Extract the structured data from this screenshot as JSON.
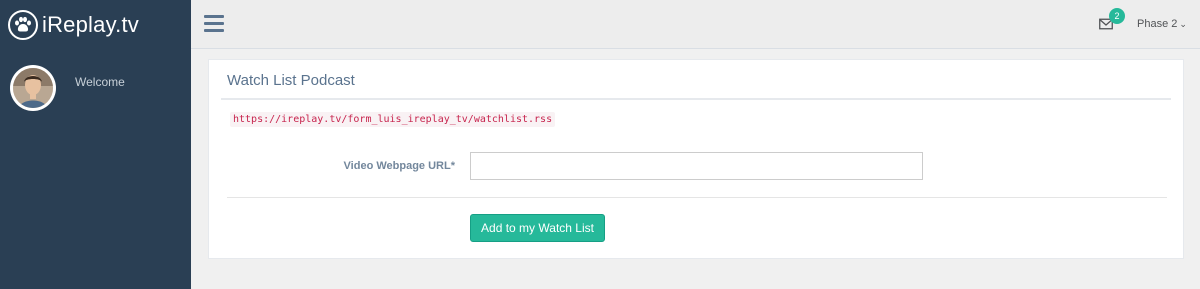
{
  "app": {
    "brand_name": "iReplay.tv",
    "brand_icon": "paw-icon"
  },
  "sidebar": {
    "welcome_text": "Welcome",
    "avatar_icon": "user-avatar"
  },
  "topnav": {
    "menu_icon": "hamburger-menu-icon",
    "mail_icon": "envelope-icon",
    "notification_count": "2",
    "user_label": "Phase 2",
    "user_caret": "⌄"
  },
  "panel": {
    "title": "Watch List Podcast",
    "rss_url": "https://ireplay.tv/form_luis_ireplay_tv/watchlist.rss",
    "field_label": "Video Webpage URL*",
    "field_value": "",
    "field_placeholder": "",
    "submit_label": "Add to my Watch List"
  },
  "colors": {
    "sidebar_bg": "#2a3f54",
    "accent": "#26b99a",
    "title_text": "#5a738e",
    "code_text": "#c7254e"
  }
}
